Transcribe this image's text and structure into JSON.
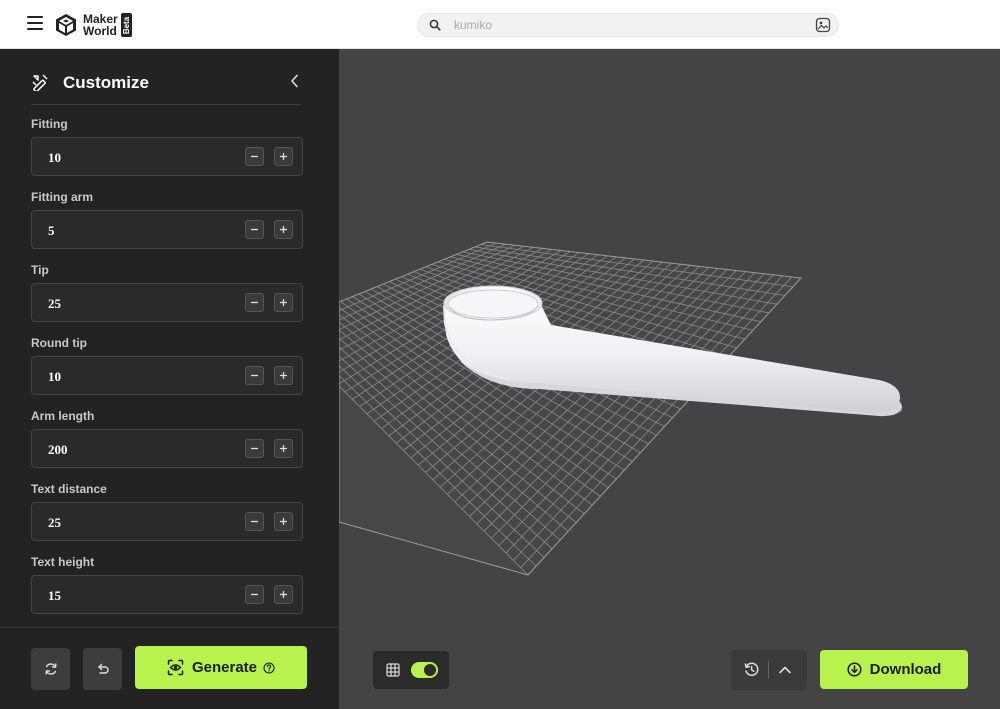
{
  "header": {
    "logo": {
      "line1": "Maker",
      "line2": "World",
      "badge": "Beta"
    },
    "search": {
      "value": "",
      "placeholder": "kumiko"
    }
  },
  "sidebar": {
    "title": "Customize",
    "params": [
      {
        "label": "Fitting",
        "value": "10"
      },
      {
        "label": "Fitting arm",
        "value": "5"
      },
      {
        "label": "Tip",
        "value": "25"
      },
      {
        "label": "Round tip",
        "value": "10"
      },
      {
        "label": "Arm length",
        "value": "200"
      },
      {
        "label": "Text distance",
        "value": "25"
      },
      {
        "label": "Text height",
        "value": "15"
      }
    ],
    "generate_label": "Generate"
  },
  "viewport": {
    "grid_toggle_on": true,
    "download_label": "Download"
  },
  "colors": {
    "accent": "#b8f24c",
    "sidebar_bg": "#232323",
    "viewport_bg": "#444444",
    "header_bg": "#ffffff"
  },
  "icons": {
    "menu": "hamburger-icon",
    "search": "search-icon",
    "image_search": "image-search-icon",
    "customize": "customize-icon",
    "collapse": "chevron-left-icon",
    "reset": "refresh-icon",
    "undo": "undo-icon",
    "generate": "eye-scan-icon",
    "help": "help-icon",
    "grid": "grid-icon",
    "history": "history-icon",
    "expand": "chevron-up-icon",
    "download": "download-icon"
  }
}
